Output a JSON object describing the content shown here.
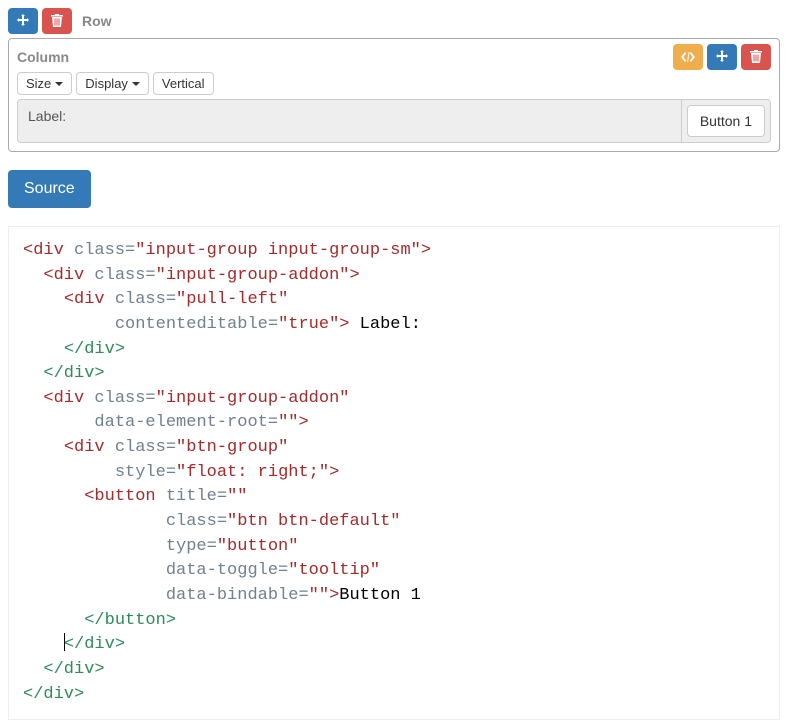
{
  "row": {
    "label": "Row"
  },
  "column": {
    "label": "Column",
    "toolbar": {
      "size": "Size",
      "display": "Display",
      "vertical": "Vertical"
    },
    "addon": {
      "label": "Label:",
      "button": "Button 1"
    }
  },
  "source_button": "Source",
  "code": {
    "l1": {
      "open": "<div",
      "attr": "class=",
      "val": "\"input-group input-group-sm\"",
      "close": ">"
    },
    "l2": {
      "open": "<div",
      "attr": "class=",
      "val": "\"input-group-addon\"",
      "close": ">"
    },
    "l3": {
      "open": "<div",
      "attr": "class=",
      "val": "\"pull-left\""
    },
    "l3b": {
      "attr": "contenteditable=",
      "val": "\"true\"",
      "close": ">",
      "text": " Label:"
    },
    "l4": {
      "close": "</div>"
    },
    "l5": {
      "close": "</div>"
    },
    "l6": {
      "open": "<div",
      "attr": "class=",
      "val": "\"input-group-addon\""
    },
    "l6b": {
      "attr": "data-element-root=",
      "val": "\"\"",
      "close": ">"
    },
    "l7": {
      "open": "<div",
      "attr": "class=",
      "val": "\"btn-group\""
    },
    "l7b": {
      "attr": "style=",
      "val": "\"float: right;\"",
      "close": ">"
    },
    "l8": {
      "open": "<button",
      "attr": "title=",
      "val": "\"\""
    },
    "l8b": {
      "attr": "class=",
      "val": "\"btn btn-default\""
    },
    "l8c": {
      "attr": "type=",
      "val": "\"button\""
    },
    "l8d": {
      "attr": "data-toggle=",
      "val": "\"tooltip\""
    },
    "l8e": {
      "attr": "data-bindable=",
      "val": "\"\"",
      "close": ">",
      "text": "Button 1"
    },
    "l9": {
      "close": "</button>"
    },
    "l10": {
      "close": "</div>"
    },
    "l11": {
      "close": "</div>"
    },
    "l12": {
      "close": "</div>"
    }
  }
}
